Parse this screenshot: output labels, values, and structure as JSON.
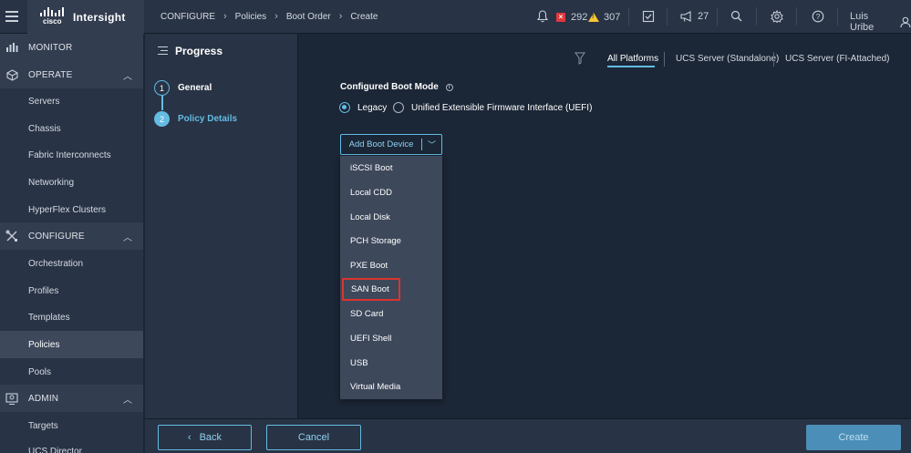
{
  "header": {
    "brand_word": "cisco",
    "app_name": "Intersight",
    "breadcrumbs": [
      "CONFIGURE",
      "Policies",
      "Boot Order",
      "Create"
    ],
    "critical_count": "292",
    "warning_count": "307",
    "announcement_count": "27",
    "user_name": "Luis Uribe"
  },
  "sidebar": {
    "sections": [
      {
        "label": "MONITOR"
      },
      {
        "label": "OPERATE"
      },
      {
        "label": "CONFIGURE"
      },
      {
        "label": "ADMIN"
      }
    ],
    "operate_items": [
      "Servers",
      "Chassis",
      "Fabric Interconnects",
      "Networking",
      "HyperFlex Clusters"
    ],
    "configure_items": [
      "Orchestration",
      "Profiles",
      "Templates",
      "Policies",
      "Pools"
    ],
    "admin_items": [
      "Targets",
      "UCS Director"
    ],
    "active_item": "Policies"
  },
  "progress": {
    "title": "Progress",
    "steps": [
      {
        "number": "1",
        "label": "General"
      },
      {
        "number": "2",
        "label": "Policy Details"
      }
    ]
  },
  "platforms": {
    "tabs": [
      "All Platforms",
      "UCS Server (Standalone)",
      "UCS Server (FI-Attached)"
    ],
    "selected": "All Platforms"
  },
  "boot_mode": {
    "label": "Configured Boot Mode",
    "options": [
      "Legacy",
      "Unified Extensible Firmware Interface (UEFI)"
    ],
    "selected": "Legacy"
  },
  "add_boot_device": {
    "label": "Add Boot Device",
    "menu": [
      "iSCSI Boot",
      "Local CDD",
      "Local Disk",
      "PCH Storage",
      "PXE Boot",
      "SAN Boot",
      "SD Card",
      "UEFI Shell",
      "USB",
      "Virtual Media"
    ],
    "highlighted": "SAN Boot"
  },
  "footer": {
    "back_label": "Back",
    "cancel_label": "Cancel",
    "create_label": "Create"
  },
  "colors": {
    "accent": "#64bbe3",
    "background": "#1b2636",
    "panel": "#283345",
    "critical": "#e0383e",
    "warning": "#f7c531",
    "highlight_border": "#d9352f"
  },
  "icons": [
    "menu-icon",
    "bell-icon",
    "critical-alarm-icon",
    "warning-alarm-icon",
    "task-icon",
    "megaphone-icon",
    "search-icon",
    "gear-icon",
    "help-icon",
    "user-icon",
    "monitor-icon",
    "operate-icon",
    "configure-icon",
    "admin-icon",
    "filter-icon",
    "info-icon"
  ]
}
